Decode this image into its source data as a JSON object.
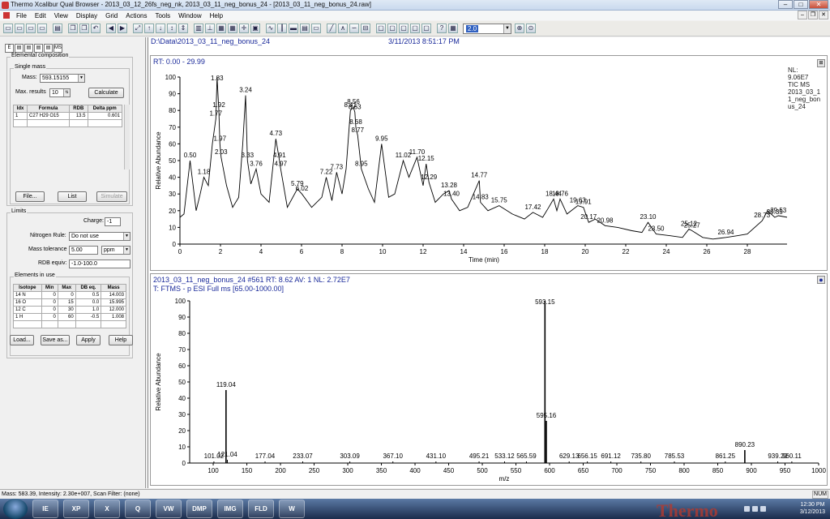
{
  "window": {
    "title": "Thermo Xcalibur Qual Browser - 2013_03_12_26fs_neg_nk, 2013_03_11_neg_bonus_24 - [2013_03_11_neg_bonus_24.raw]"
  },
  "menu": [
    "File",
    "Edit",
    "View",
    "Display",
    "Grid",
    "Actions",
    "Tools",
    "Window",
    "Help"
  ],
  "toolbar": {
    "zoom_value": "2.0"
  },
  "left": {
    "group_elemental": "Elemental composition",
    "group_single": "Single mass",
    "mass_label": "Mass:",
    "mass_value": "593.15155",
    "maxres_label": "Max. results",
    "maxres_value": "10",
    "calculate": "Calculate",
    "results_headers": [
      "Idx",
      "Formula",
      "RDB",
      "Delta ppm"
    ],
    "result_row": {
      "idx": "1",
      "formula": "C27 H29 O15",
      "rdb": "13.5",
      "delta": "0.601"
    },
    "file_btn": "File...",
    "list_btn": "List",
    "simulate_btn": "Simulate",
    "group_limits": "Limits",
    "charge_label": "Charge:",
    "charge_value": "-1",
    "nrule_label": "Nitrogen Rule:",
    "nrule_value": "Do not use",
    "masstol_label": "Mass tolerance",
    "masstol_value": "5.00",
    "masstol_unit": "ppm",
    "rdb_label": "RDB equiv:",
    "rdb_value": "-1.0-100.0",
    "group_elements": "Elements in use",
    "elements_headers": [
      "Isotope",
      "Min",
      "Max",
      "DB eq.",
      "Mass"
    ],
    "elements": [
      [
        "14 N",
        "0",
        "0",
        "0.5",
        "14.003"
      ],
      [
        "16 O",
        "0",
        "15",
        "0.0",
        "15.995"
      ],
      [
        "12 C",
        "0",
        "30",
        "1.0",
        "12.000"
      ],
      [
        "1 H",
        "0",
        "60",
        "-0.5",
        "1.008"
      ]
    ],
    "load_btn": "Load...",
    "saveas_btn": "Save as...",
    "apply_btn": "Apply",
    "help_btn": "Help"
  },
  "header": {
    "path": "D:\\Data\\2013_03_11_neg_bonus_24",
    "datetime": "3/11/2013 8:51:17 PM"
  },
  "top_pane": {
    "rt_range": "RT: 0.00 - 29.99",
    "info": [
      "NL:",
      "9.06E7",
      "TIC  MS",
      "2013_03_1",
      "1_neg_bon",
      "us_24"
    ]
  },
  "bottom_pane": {
    "line1": "2013_03_11_neg_bonus_24 #561   RT: 8.62   AV: 1   NL: 2.72E7",
    "line2": "T: FTMS - p ESI Full ms [65.00-1000.00]"
  },
  "chart_data": [
    {
      "type": "line",
      "title": "",
      "xlabel": "Time (min)",
      "ylabel": "Relative Abundance",
      "xlim": [
        0,
        30
      ],
      "ylim": [
        0,
        100
      ],
      "xticks": [
        0,
        2,
        4,
        6,
        8,
        10,
        12,
        14,
        16,
        18,
        20,
        22,
        24,
        26,
        28
      ],
      "yticks": [
        0,
        10,
        20,
        30,
        40,
        50,
        60,
        70,
        80,
        90,
        100
      ],
      "series": [
        {
          "x": [
            0,
            0.2,
            0.5,
            0.8,
            1.0,
            1.18,
            1.4,
            1.6,
            1.77,
            1.83,
            1.92,
            1.97,
            2.03,
            2.3,
            2.6,
            2.9,
            3.1,
            3.24,
            3.33,
            3.5,
            3.76,
            4.0,
            4.4,
            4.73,
            4.91,
            4.97,
            5.3,
            5.79,
            6.02,
            6.5,
            7.0,
            7.22,
            7.5,
            7.73,
            8.0,
            8.2,
            8.41,
            8.56,
            8.63,
            8.68,
            8.77,
            8.95,
            9.3,
            9.6,
            9.95,
            10.3,
            10.6,
            11.02,
            11.3,
            11.7,
            12.0,
            12.15,
            12.29,
            12.6,
            13.0,
            13.28,
            13.4,
            13.8,
            14.2,
            14.77,
            14.83,
            15.2,
            15.75,
            16.4,
            17.0,
            17.42,
            17.9,
            18.2,
            18.44,
            18.6,
            18.76,
            19.1,
            19.63,
            19.91,
            20.17,
            20.5,
            20.98,
            21.6,
            22.3,
            22.8,
            23.1,
            23.5,
            24.2,
            24.8,
            25.12,
            25.27,
            25.8,
            26.3,
            26.94,
            27.5,
            28.0,
            28.73,
            29.0,
            29.35,
            29.53,
            29.99
          ],
          "y": [
            16,
            18,
            50,
            20,
            30,
            40,
            35,
            60,
            75,
            100,
            80,
            60,
            52,
            35,
            22,
            28,
            60,
            89,
            50,
            36,
            45,
            30,
            25,
            63,
            50,
            45,
            22,
            33,
            30,
            22,
            28,
            40,
            26,
            43,
            30,
            45,
            80,
            82,
            79,
            70,
            65,
            45,
            33,
            25,
            60,
            28,
            30,
            50,
            40,
            52,
            35,
            48,
            37,
            25,
            30,
            32,
            27,
            20,
            22,
            38,
            25,
            20,
            23,
            18,
            15,
            19,
            16,
            22,
            27,
            20,
            27,
            18,
            23,
            22,
            13,
            15,
            11,
            10,
            8,
            7,
            13,
            6,
            5,
            4,
            9,
            8,
            4,
            3,
            4,
            5,
            6,
            14,
            20,
            16,
            17,
            16
          ]
        }
      ],
      "annotations": [
        "0.50",
        "1.18",
        "1.77",
        "1.83",
        "1.92",
        "1.97",
        "2.03",
        "3.24",
        "3.33",
        "3.76",
        "4.73",
        "4.91",
        "4.97",
        "5.79",
        "6.02",
        "7.22",
        "7.73",
        "8.41",
        "8.56",
        "8.63",
        "8.68",
        "8.77",
        "8.95",
        "9.95",
        "11.02",
        "11.70",
        "12.15",
        "12.29",
        "13.28",
        "13.40",
        "14.77",
        "14.83",
        "15.75",
        "17.42",
        "18.44",
        "18.76",
        "19.63",
        "19.91",
        "20.17",
        "20.98",
        "23.10",
        "23.50",
        "25.12",
        "25.27",
        "26.94",
        "28.73",
        "29.35",
        "29.53"
      ]
    },
    {
      "type": "bar",
      "title": "",
      "xlabel": "m/z",
      "ylabel": "Relative Abundance",
      "xlim": [
        65,
        1000
      ],
      "ylim": [
        0,
        100
      ],
      "xticks": [
        100,
        150,
        200,
        250,
        300,
        350,
        400,
        450,
        500,
        550,
        600,
        650,
        700,
        750,
        800,
        850,
        900,
        950,
        1000
      ],
      "yticks": [
        0,
        10,
        20,
        30,
        40,
        50,
        60,
        70,
        80,
        90,
        100
      ],
      "peaks": [
        {
          "x": 101.02,
          "y": 1
        },
        {
          "x": 119.04,
          "y": 45
        },
        {
          "x": 121.04,
          "y": 2
        },
        {
          "x": 177.04,
          "y": 1
        },
        {
          "x": 233.07,
          "y": 1
        },
        {
          "x": 303.09,
          "y": 1
        },
        {
          "x": 367.1,
          "y": 1
        },
        {
          "x": 431.1,
          "y": 1
        },
        {
          "x": 495.21,
          "y": 1
        },
        {
          "x": 533.12,
          "y": 1
        },
        {
          "x": 565.59,
          "y": 1
        },
        {
          "x": 593.15,
          "y": 100
        },
        {
          "x": 595.16,
          "y": 26
        },
        {
          "x": 629.13,
          "y": 1
        },
        {
          "x": 656.15,
          "y": 1
        },
        {
          "x": 691.12,
          "y": 1
        },
        {
          "x": 735.8,
          "y": 1
        },
        {
          "x": 785.53,
          "y": 1
        },
        {
          "x": 861.25,
          "y": 1
        },
        {
          "x": 890.23,
          "y": 8
        },
        {
          "x": 939.22,
          "y": 1
        },
        {
          "x": 960.11,
          "y": 1
        }
      ],
      "labels": [
        "101.02",
        "119.04",
        "121.04",
        "177.04",
        "233.07",
        "303.09",
        "367.10",
        "431.10",
        "495.21",
        "533.12",
        "565.59",
        "593.15",
        "595.16",
        "629.13",
        "656.15",
        "691.12",
        "735.80",
        "785.53",
        "861.25",
        "890.23",
        "939.22",
        "960.11"
      ]
    }
  ],
  "status": {
    "text": "Mass: 583.39, Intensity: 2.30e+007, Scan Filter: (none)",
    "num": "NUM"
  },
  "taskbar": {
    "apps": [
      "IE",
      "XP",
      "X",
      "Q",
      "VW",
      "DMP",
      "IMG",
      "FLD",
      "W"
    ],
    "wallpaper": "Thermo",
    "time": "12:30 PM",
    "date": "3/12/2013"
  }
}
